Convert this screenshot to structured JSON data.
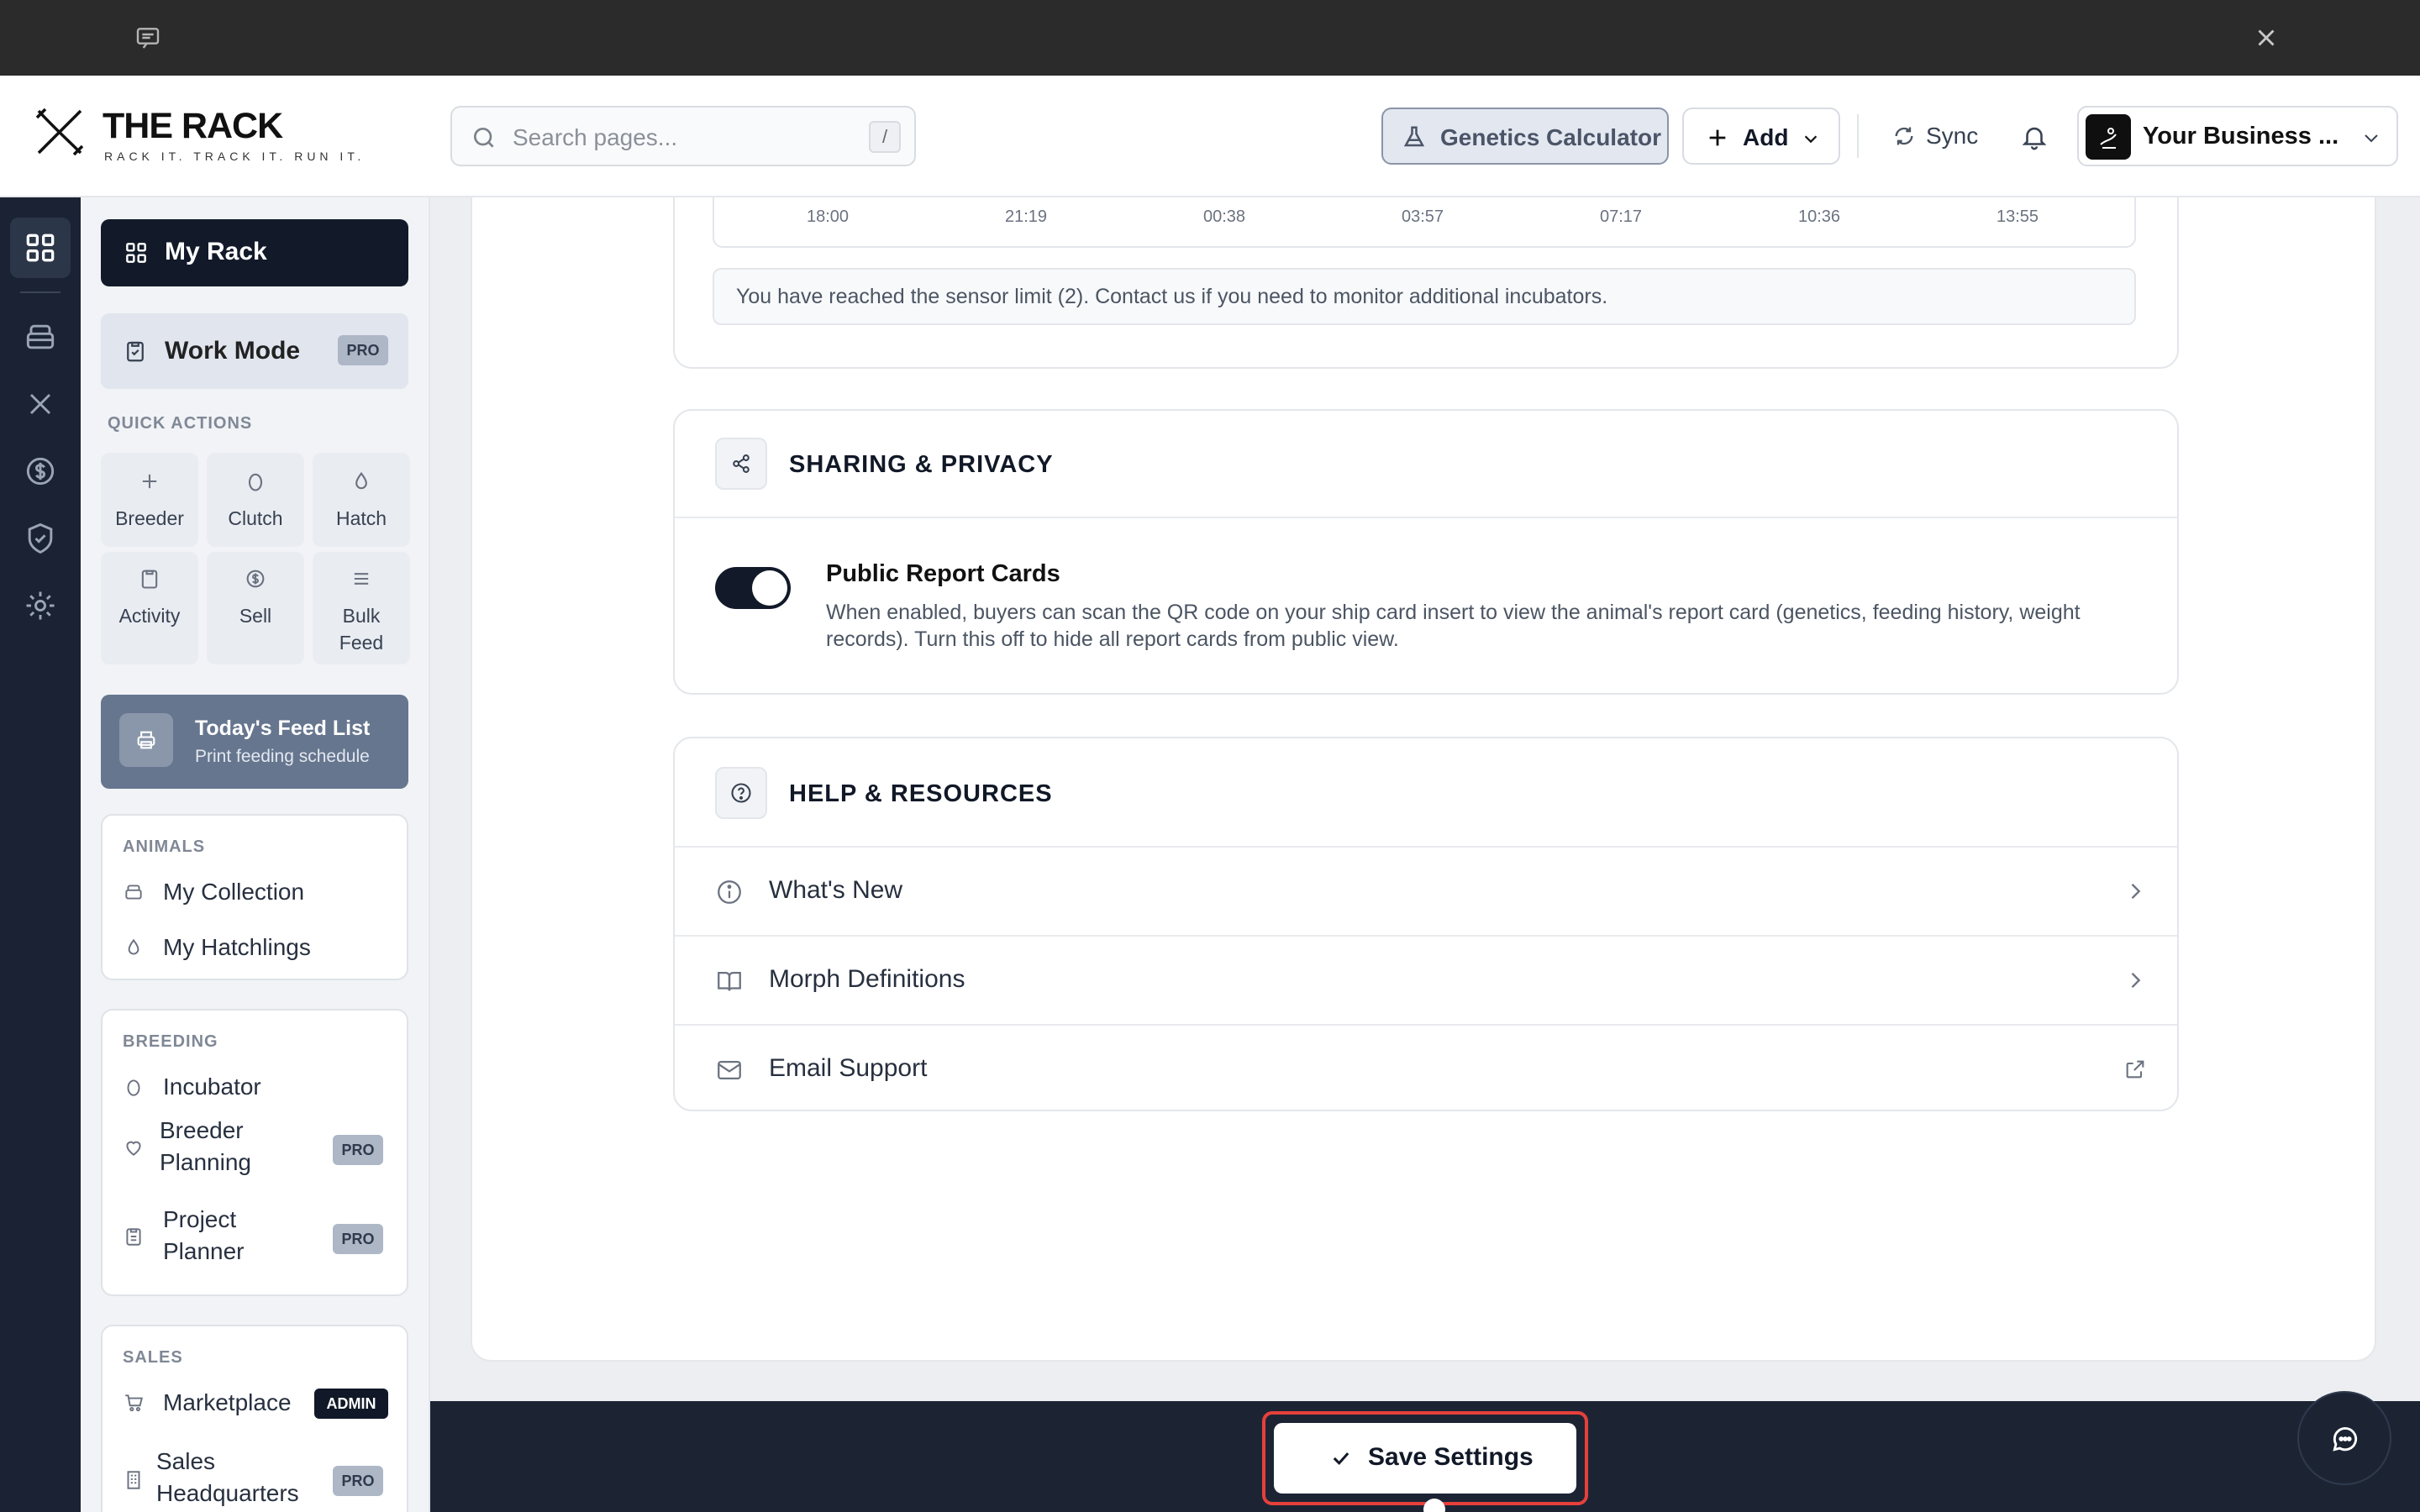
{
  "header": {
    "brand_title": "THE RACK",
    "brand_tagline": "RACK IT. TRACK IT. RUN IT.",
    "search_placeholder": "Search pages...",
    "search_shortcut": "/",
    "genetics_label": "Genetics Calculator",
    "add_label": "Add",
    "sync_label": "Sync",
    "account_label": "Your Business ..."
  },
  "rail": {
    "icons": [
      "dashboard-icon",
      "collection-icon",
      "breeding-icon",
      "sales-icon",
      "shield-icon",
      "settings-icon"
    ]
  },
  "sidebar": {
    "my_rack": "My Rack",
    "work_mode": "Work Mode",
    "pro_badge": "PRO",
    "admin_badge": "ADMIN",
    "quick_actions_heading": "QUICK ACTIONS",
    "quick_actions": [
      {
        "label": "Breeder",
        "icon": "plus-icon"
      },
      {
        "label": "Clutch",
        "icon": "egg-icon"
      },
      {
        "label": "Hatch",
        "icon": "drop-icon"
      },
      {
        "label": "Activity",
        "icon": "clipboard-icon"
      },
      {
        "label": "Sell",
        "icon": "dollar-icon"
      },
      {
        "label": "Bulk",
        "label2": "Feed",
        "icon": "list-icon"
      }
    ],
    "feed_list_title": "Today's Feed List",
    "feed_list_subtitle": "Print feeding schedule",
    "animals_heading": "ANIMALS",
    "animals_items": [
      "My Collection",
      "My Hatchlings"
    ],
    "breeding_heading": "BREEDING",
    "breeding_items": [
      {
        "line1": "Incubator",
        "line2": ""
      },
      {
        "line1": "Breeder",
        "line2": "Planning"
      },
      {
        "line1": "Project",
        "line2": "Planner"
      }
    ],
    "sales_heading": "SALES",
    "sales_items": [
      {
        "line1": "Marketplace",
        "line2": ""
      },
      {
        "line1": "Sales",
        "line2": "Headquarters"
      }
    ]
  },
  "main": {
    "chart_ticks": [
      "18:00",
      "21:19",
      "00:38",
      "03:57",
      "07:17",
      "10:36",
      "13:55"
    ],
    "sensor_limit_note": "You have reached the sensor limit (2). Contact us if you need to monitor additional incubators.",
    "sharing": {
      "title": "SHARING & PRIVACY",
      "toggle_on": true,
      "public_report_cards_title": "Public Report Cards",
      "public_report_cards_desc": "When enabled, buyers can scan the QR code on your ship card insert to view the animal's report card (genetics, feeding history, weight records). Turn this off to hide all report cards from public view."
    },
    "help": {
      "title": "HELP & RESOURCES",
      "items": [
        {
          "label": "What's New",
          "icon": "info-icon",
          "trail": "chevron-right-icon"
        },
        {
          "label": "Morph Definitions",
          "icon": "book-icon",
          "trail": "chevron-right-icon"
        },
        {
          "label": "Email Support",
          "icon": "mail-icon",
          "trail": "external-link-icon"
        }
      ]
    }
  },
  "footer": {
    "save_label": "Save Settings"
  },
  "colors": {
    "navy": "#121a2a",
    "rail": "#1a2234",
    "highlight": "#e5403b"
  }
}
